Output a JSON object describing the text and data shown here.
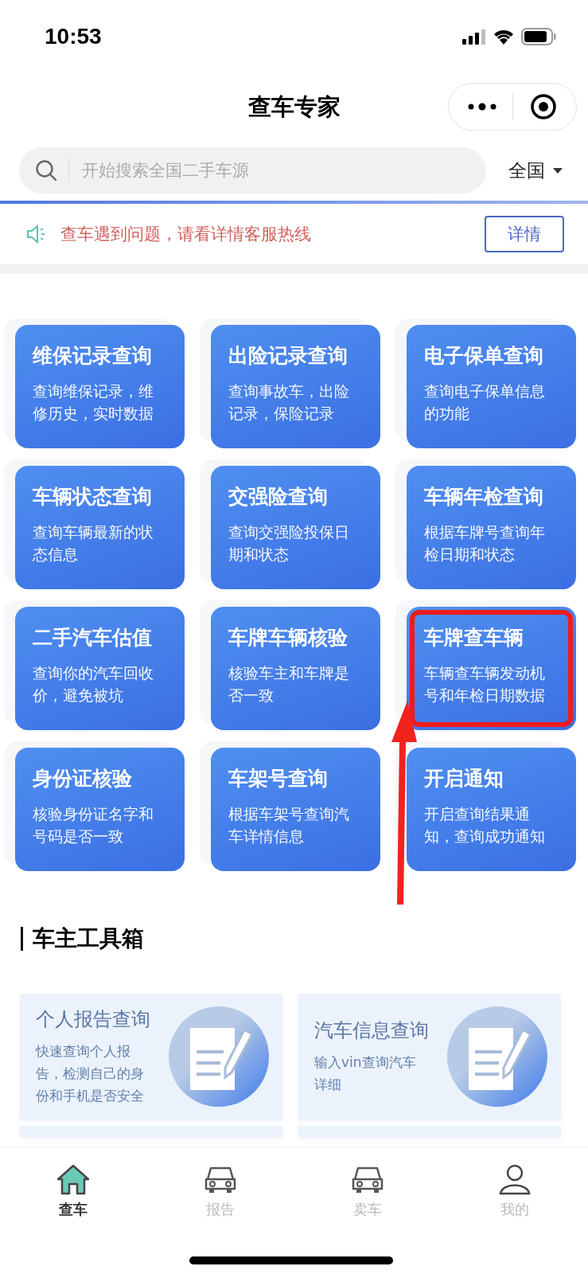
{
  "status_bar": {
    "time": "10:53"
  },
  "nav": {
    "title": "查车专家"
  },
  "search": {
    "placeholder": "开始搜索全国二手车源",
    "region": "全国"
  },
  "notice": {
    "text": "查车遇到问题，请看详情客服热线",
    "button": "详情"
  },
  "services": [
    {
      "title": "维保记录查询",
      "desc": "查询维保记录，维修历史，实时数据",
      "highlighted": false
    },
    {
      "title": "出险记录查询",
      "desc": "查询事故车，出险记录，保险记录",
      "highlighted": false
    },
    {
      "title": "电子保单查询",
      "desc": "查询电子保单信息的功能",
      "highlighted": false
    },
    {
      "title": "车辆状态查询",
      "desc": "查询车辆最新的状态信息",
      "highlighted": false
    },
    {
      "title": "交强险查询",
      "desc": "查询交强险投保日期和状态",
      "highlighted": false
    },
    {
      "title": "车辆年检查询",
      "desc": "根据车牌号查询年检日期和状态",
      "highlighted": false
    },
    {
      "title": "二手汽车估值",
      "desc": "查询你的汽车回收价，避免被坑",
      "highlighted": false
    },
    {
      "title": "车牌车辆核验",
      "desc": "核验车主和车牌是否一致",
      "highlighted": false
    },
    {
      "title": "车牌查车辆",
      "desc": "车辆查车辆发动机号和年检日期数据",
      "highlighted": true
    },
    {
      "title": "身份证核验",
      "desc": "核验身份证名字和号码是否一致",
      "highlighted": false
    },
    {
      "title": "车架号查询",
      "desc": "根据车架号查询汽车详情信息",
      "highlighted": false
    },
    {
      "title": "开启通知",
      "desc": "开启查询结果通知，查询成功通知",
      "highlighted": false
    }
  ],
  "toolbox": {
    "heading": "车主工具箱",
    "items": [
      {
        "title": "个人报告查询",
        "desc": "快速查询个人报告，检测自己的身份和手机是否安全"
      },
      {
        "title": "汽车信息查询",
        "desc": "输入vin查询汽车详细"
      }
    ]
  },
  "tab_bar": [
    {
      "label": "查车",
      "kind": "home",
      "selected": true
    },
    {
      "label": "报告",
      "kind": "car",
      "selected": false
    },
    {
      "label": "卖车",
      "kind": "car",
      "selected": false
    },
    {
      "label": "我的",
      "kind": "user",
      "selected": false
    }
  ]
}
